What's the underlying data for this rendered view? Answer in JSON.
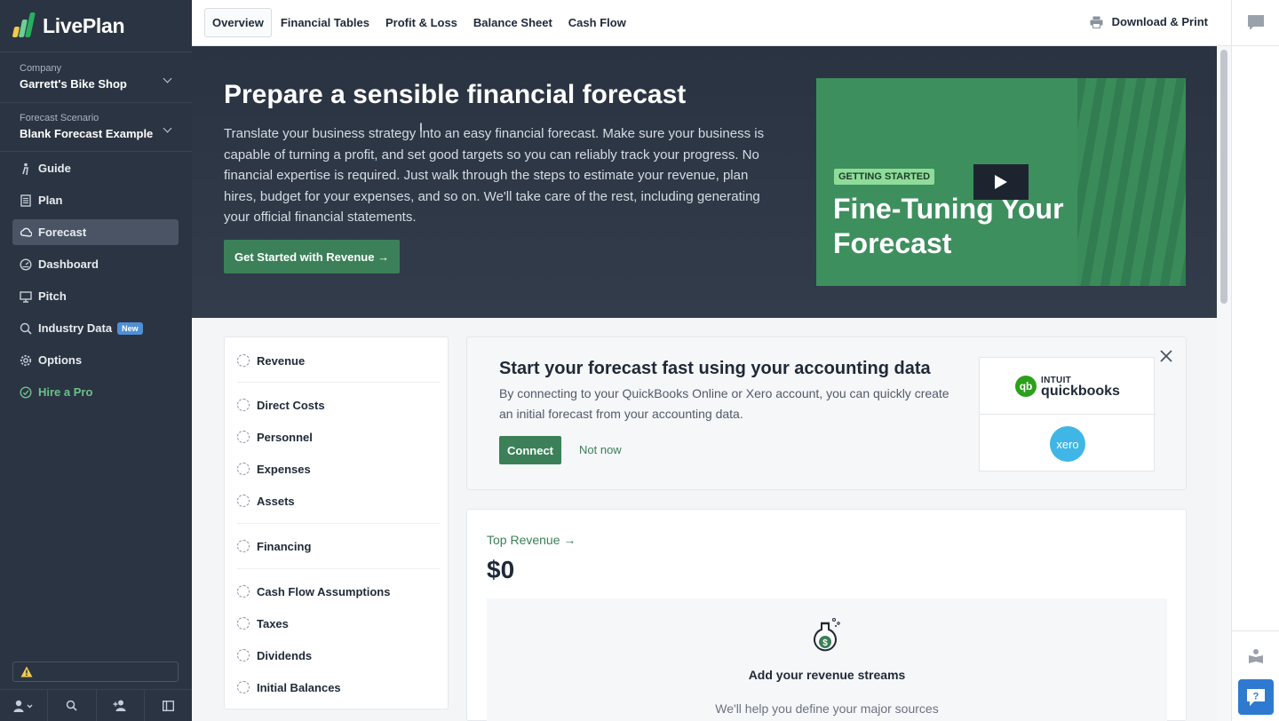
{
  "app": {
    "name": "LivePlan"
  },
  "sidebar": {
    "company": {
      "label": "Company",
      "value": "Garrett's Bike Shop"
    },
    "scenario": {
      "label": "Forecast Scenario",
      "value": "Blank Forecast Example"
    },
    "items": [
      {
        "label": "Guide",
        "icon": "guide-icon"
      },
      {
        "label": "Plan",
        "icon": "plan-icon"
      },
      {
        "label": "Forecast",
        "icon": "forecast-icon",
        "active": true
      },
      {
        "label": "Dashboard",
        "icon": "dashboard-icon"
      },
      {
        "label": "Pitch",
        "icon": "pitch-icon"
      },
      {
        "label": "Industry Data",
        "icon": "industry-data-icon",
        "badge": "New"
      },
      {
        "label": "Options",
        "icon": "gear-icon"
      },
      {
        "label": "Hire a Pro",
        "icon": "check-circle-icon"
      }
    ]
  },
  "topbar": {
    "tabs": [
      "Overview",
      "Financial Tables",
      "Profit & Loss",
      "Balance Sheet",
      "Cash Flow"
    ],
    "download_label": "Download & Print"
  },
  "hero": {
    "title": "Prepare a sensible financial forecast",
    "body": "Translate your business strategy into an easy financial forecast. Make sure your business is capable of turning a profit, and set good targets so you can reliably track your progress. No financial expertise is required. Just walk through the steps to estimate your revenue, plan hires, budget for your expenses, and so on. We'll take care of the rest, including generating your official financial statements.",
    "button": "Get Started with Revenue →",
    "video": {
      "tag": "GETTING STARTED",
      "title": "Fine-Tuning Your Forecast"
    }
  },
  "steps": [
    "Revenue",
    "Direct Costs",
    "Personnel",
    "Expenses",
    "Assets",
    "Financing",
    "Cash Flow Assumptions",
    "Taxes",
    "Dividends",
    "Initial Balances"
  ],
  "accounting": {
    "title": "Start your forecast fast using your accounting data",
    "body": "By connecting to your QuickBooks Online or Xero account, you can quickly create an initial forecast from your accounting data.",
    "connect": "Connect",
    "not_now": "Not now",
    "quickbooks": {
      "brand": "INTUIT",
      "name": "quickbooks"
    },
    "xero": "xero"
  },
  "revenue": {
    "link": "Top Revenue →",
    "value": "$0",
    "empty_title": "Add your revenue streams",
    "empty_sub": "We'll help you define your major sources"
  },
  "colors": {
    "sidebar": "#2b3442",
    "accent_green": "#3b8058",
    "hero": "#2a3341",
    "video": "#3e8f5e",
    "help_blue": "#2f7ad1"
  }
}
